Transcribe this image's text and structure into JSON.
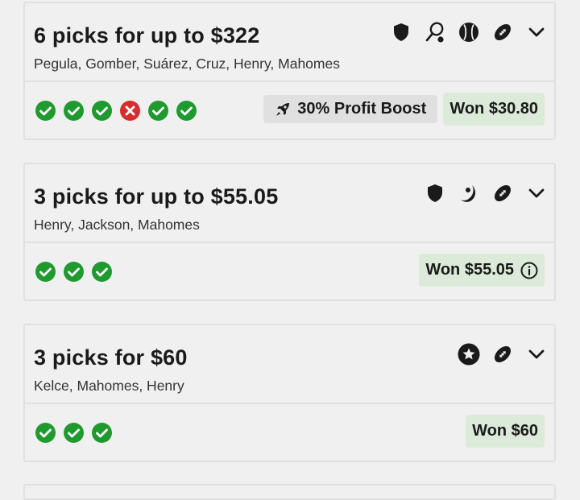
{
  "colors": {
    "check_green": "#1f9a2e",
    "fail_red": "#d32f2f",
    "won_bg": "#dcebd9",
    "boost_bg": "#e0e0e0"
  },
  "entries": [
    {
      "title": "6 picks for up to $322",
      "players": "Pegula, Gomber, Suárez, Cruz, Henry, Mahomes",
      "icons": [
        "shield-icon",
        "tennis-racket-icon",
        "baseball-icon",
        "football-icon",
        "chevron-down-icon"
      ],
      "results": [
        "win",
        "win",
        "win",
        "loss",
        "win",
        "win"
      ],
      "boost": "30% Profit Boost",
      "won": "Won $30.80"
    },
    {
      "title": "3 picks for up to $55.05",
      "players": "Henry, Jackson, Mahomes",
      "icons": [
        "shield-icon",
        "moon-icon",
        "football-icon",
        "chevron-down-icon"
      ],
      "results": [
        "win",
        "win",
        "win"
      ],
      "won": "Won $55.05"
    },
    {
      "title": "3 picks for $60",
      "players": "Kelce, Mahomes, Henry",
      "icons": [
        "star-icon",
        "football-icon",
        "chevron-down-icon"
      ],
      "results": [
        "win",
        "win",
        "win"
      ],
      "won": "Won $60"
    }
  ]
}
